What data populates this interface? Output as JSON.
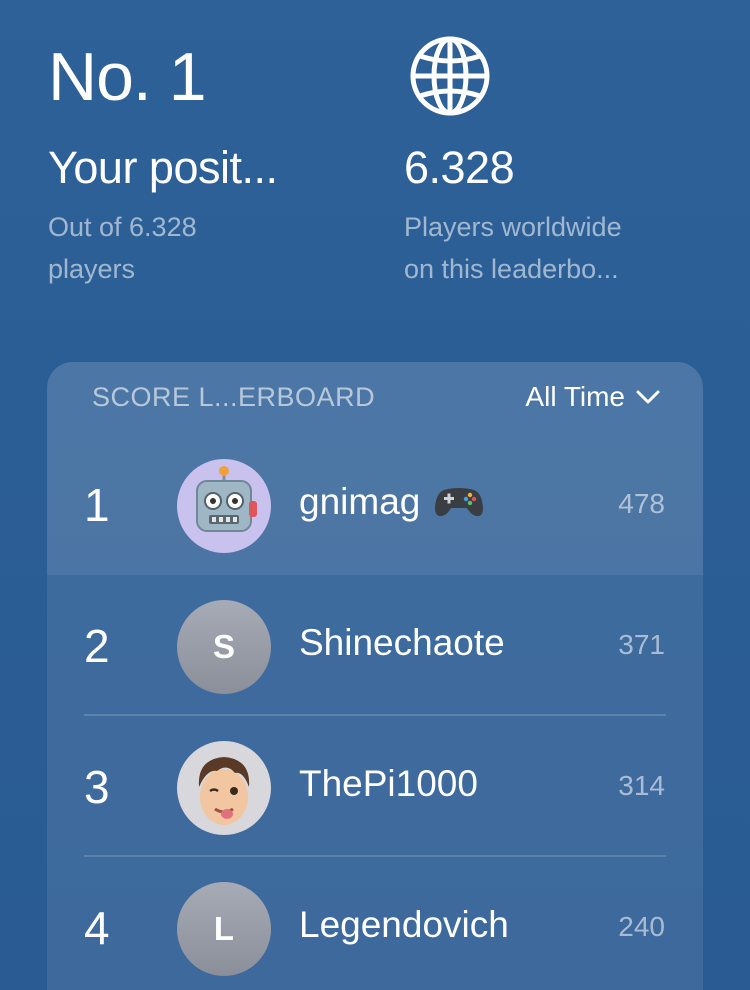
{
  "position": {
    "rank": "No. 1",
    "title": "Your posit...",
    "subtitle_line1": "Out of 6.328",
    "subtitle_line2": "players"
  },
  "worldwide": {
    "icon": "globe-icon",
    "count": "6.328",
    "subtitle_line1": "Players worldwide",
    "subtitle_line2": "on this leaderbo..."
  },
  "leaderboard": {
    "title": "SCORE L...ERBOARD",
    "filter_label": "All Time",
    "rows": [
      {
        "rank": "1",
        "name": "gnimag",
        "score": "478",
        "avatar": "robot-avatar",
        "badge": "gamepad-icon"
      },
      {
        "rank": "2",
        "name": "Shinechaote",
        "score": "371",
        "avatar_letter": "S"
      },
      {
        "rank": "3",
        "name": "ThePi1000",
        "score": "314",
        "avatar": "memoji-avatar"
      },
      {
        "rank": "4",
        "name": "Legendovich",
        "score": "240",
        "avatar_letter": "L"
      }
    ]
  }
}
